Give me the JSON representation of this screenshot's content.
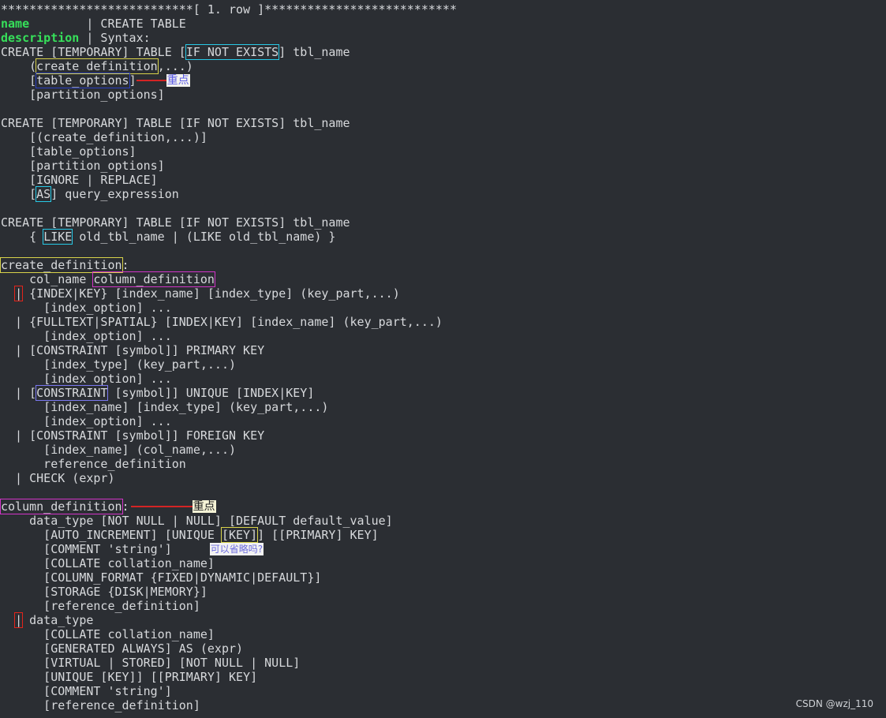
{
  "terminal": {
    "row_header": "***************************[ 1. row ]***************************",
    "name_label": "name",
    "name_value": "        | CREATE TABLE",
    "description_label": "description",
    "description_value": " | Syntax:",
    "lines": {
      "l1_pre": "CREATE [TEMPORARY] TABLE [",
      "l1_box": "IF NOT EXISTS",
      "l1_post": "] tbl_name",
      "l2_pre": "    (",
      "l2_box": "create_definition",
      "l2_post": ",...)",
      "l3_pre": "    [",
      "l3_box": "table_options",
      "l3_post": "]",
      "l4": "    [partition_options]",
      "l6": "CREATE [TEMPORARY] TABLE [IF NOT EXISTS] tbl_name",
      "l7": "    [(create_definition,...)]",
      "l8": "    [table_options]",
      "l9": "    [partition_options]",
      "l10": "    [IGNORE | REPLACE]",
      "l11_pre": "    [",
      "l11_box": "AS",
      "l11_post": "] query_expression",
      "l13": "CREATE [TEMPORARY] TABLE [IF NOT EXISTS] tbl_name",
      "l14_pre": "    { ",
      "l14_box": "LIKE",
      "l14_post": " old_tbl_name | (LIKE old_tbl_name) }",
      "l16_box": "create_definition",
      "l16_post": ":",
      "l17_pre": "    col_name ",
      "l17_box": "column_definition",
      "l18_pre": "  ",
      "l18_box": "|",
      "l18_post": " {INDEX|KEY} [index_name] [index_type] (key_part,...)",
      "l19": "      [index_option] ...",
      "l20": "  | {FULLTEXT|SPATIAL} [INDEX|KEY] [index_name] (key_part,...)",
      "l21": "      [index_option] ...",
      "l22": "  | [CONSTRAINT [symbol]] PRIMARY KEY",
      "l23": "      [index_type] (key_part,...)",
      "l24": "      [index_option] ...",
      "l25_pre": "  | [",
      "l25_box": "CONSTRAINT",
      "l25_post": " [symbol]] UNIQUE [INDEX|KEY]",
      "l26": "      [index_name] [index_type] (key_part,...)",
      "l27": "      [index_option] ...",
      "l28": "  | [CONSTRAINT [symbol]] FOREIGN KEY",
      "l29": "      [index_name] (col_name,...)",
      "l30": "      reference_definition",
      "l31": "  | CHECK (expr)",
      "l33_box": "column_definition",
      "l33_post": ":",
      "l34": "    data_type [NOT NULL | NULL] [DEFAULT default_value]",
      "l35_pre": "      [AUTO_INCREMENT] [UNIQUE ",
      "l35_box": "[KEY]",
      "l35_post": "] [[PRIMARY] KEY]",
      "l36": "      [COMMENT 'string']",
      "l37": "      [COLLATE collation_name]",
      "l38": "      [COLUMN_FORMAT {FIXED|DYNAMIC|DEFAULT}]",
      "l39": "      [STORAGE {DISK|MEMORY}]",
      "l40": "      [reference_definition]",
      "l41_pre": "  ",
      "l41_box": "|",
      "l41_post": " data_type",
      "l42": "      [COLLATE collation_name]",
      "l43": "      [GENERATED ALWAYS] AS (expr)",
      "l44": "      [VIRTUAL | STORED] [NOT NULL | NULL]",
      "l45": "      [UNIQUE [KEY]] [[PRIMARY] KEY]",
      "l46": "      [COMMENT 'string']",
      "l47": "      [reference_definition]"
    }
  },
  "annotations": {
    "table_options_note": "重点",
    "column_definition_note": "重点",
    "key_question_note": "可以省略吗?"
  },
  "watermark": "CSDN @wzj_110",
  "colors": {
    "background": "#2b2e33",
    "text": "#d7d9dc",
    "label_green": "#36e05a",
    "box_cyan": "#27c9e6",
    "box_yellow": "#d8d24a",
    "box_magenta": "#d234c8",
    "box_red": "#e2241b",
    "arrow_red": "#d42424"
  }
}
